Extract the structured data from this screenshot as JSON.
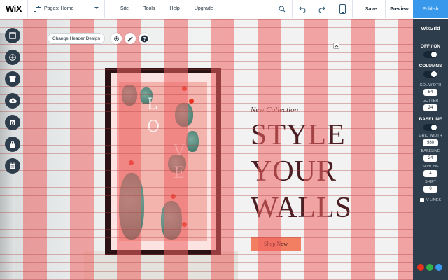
{
  "app": {
    "logo": "WiX"
  },
  "pages": {
    "label": "Pages: Home"
  },
  "menu": [
    "Site",
    "Tools",
    "Help",
    "Upgrade"
  ],
  "actions": {
    "save": "Save",
    "preview": "Preview",
    "publish": "Publish"
  },
  "canvas": {
    "header_button": "Change Header Design",
    "tagline": "New Collection",
    "headline": [
      "STYLE",
      "YOUR",
      "WALLS"
    ],
    "cta": "Shop Now",
    "poster_letters": [
      "L",
      "O",
      "V",
      "E"
    ]
  },
  "panel": {
    "title": "WixGrid",
    "off_on": "OFF / ON",
    "columns": "COLUMNS",
    "col_width_label": "COL WIDTH",
    "col_width": "54",
    "gutter_label": "GUTTER",
    "gutter": "24",
    "baseline_header": "BASELINE",
    "grid_width_label": "GRID WIDTH",
    "grid_width": "980",
    "baseline_label": "BASELINE",
    "baseline": "24",
    "subline_label": "SUBLINE",
    "subline": "4",
    "shift_label": "SHIFT",
    "shift": "0",
    "vlines": "V LINES"
  },
  "colors": {
    "accent": "#3899ec",
    "panel": "#2d3d4b",
    "cta": "#f27f62",
    "swatch_red": "#e8341e",
    "swatch_green": "#34b24a",
    "swatch_blue": "#3899ec"
  },
  "icons": [
    "pages-icon",
    "zoom-icon",
    "undo-icon",
    "redo-icon",
    "mobile-icon",
    "gear-icon",
    "brush-icon",
    "help-icon",
    "background-icon",
    "add-icon",
    "app-market-icon",
    "upload-icon",
    "blog-icon",
    "store-icon",
    "bookings-icon"
  ]
}
